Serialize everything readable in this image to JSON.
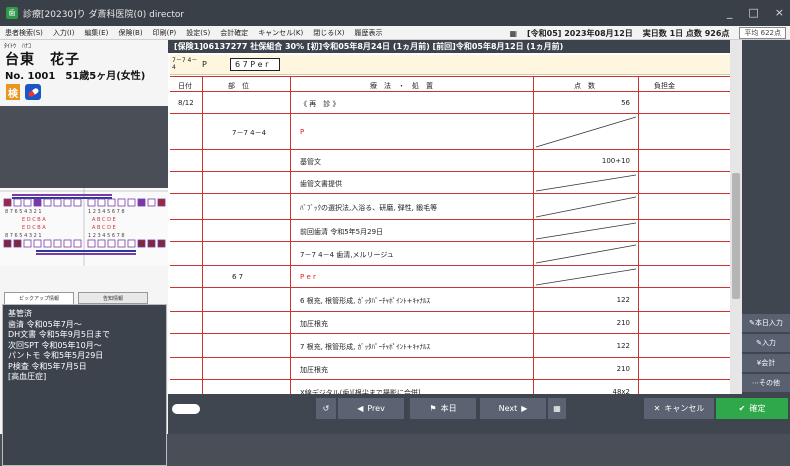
{
  "window": {
    "title": "診療[20230]り ダ斎科医院(0) director",
    "controls": [
      "_",
      "□",
      "×"
    ]
  },
  "menu": {
    "items": [
      "患者検索(S)",
      "入力(I)",
      "編集(E)",
      "保険(B)",
      "印刷(P)",
      "設定(S)",
      "会計確定",
      "キャンセル(K)",
      "閉じる(X)",
      "履歴表示"
    ],
    "date_label": "[令和05] 2023年08月12日",
    "visit_info": "実日数 1日 点数 926点",
    "points_box": "平均 622点"
  },
  "patient": {
    "kana": "ﾀｲﾄｳ　ﾊﾅｺ",
    "name": "台東　花子",
    "number_line": "No.  1001　51歳5ヶ月(女性)",
    "badge_ken": "検"
  },
  "left_tabs": [
    "ピックアップ情報",
    "告知情報"
  ],
  "pickup": {
    "lines": [
      "基管済",
      "歯清 令和05年7月～",
      "DH文書 令和5年9月5日まで",
      "次回SPT 令和05年10月～",
      "パントモ 令和5年5月29日",
      "P検査 令和5年7月5日",
      "[高血圧症]"
    ]
  },
  "insurance_bar": "[保険1]06137277 社保組合 30%  [初]令和05年8月24日 (1ヵ月前)  [前回]令和05年8月12日 (1ヵ月前)",
  "header_cell": {
    "tooth": "7－7 4－4",
    "code": "P",
    "entry": "6 7 P e r"
  },
  "columns": {
    "date": "日付",
    "site": "部　位",
    "treatment": "療　法　・　処　置",
    "points": "点　数",
    "copay": "負担金"
  },
  "rows": [
    {
      "date": "8/12",
      "site": "",
      "text": "《 再　診 》",
      "points": "56",
      "slash": false,
      "red": false
    },
    {
      "date": "",
      "site": "7－7 4－4",
      "text": "P",
      "points": "",
      "slash": true,
      "red": true
    },
    {
      "date": "",
      "site": "",
      "text": "基管文",
      "points": "100+10",
      "slash": false,
      "red": false
    },
    {
      "date": "",
      "site": "",
      "text": "歯管文書提供",
      "points": "",
      "slash": true,
      "red": false
    },
    {
      "date": "",
      "site": "",
      "text": "ﾊﾞﾌﾞｯｸの選択法,入浴る、研磨, 弾性, 鍛毛等",
      "points": "",
      "slash": true,
      "red": false
    },
    {
      "date": "",
      "site": "",
      "text": "前回歯清 令和5年5月29日",
      "points": "",
      "slash": true,
      "red": false
    },
    {
      "date": "",
      "site": "",
      "text": "7－7 4－4 歯清,メルリージュ",
      "points": "",
      "slash": true,
      "red": false
    },
    {
      "date": "",
      "site": "6 7",
      "text": "P e r",
      "points": "",
      "slash": true,
      "red": true
    },
    {
      "date": "",
      "site": "",
      "text": "6 根充, 根管形成, ｶﾞｯﾀﾊﾟｰﾁｬﾎﾟｲﾝﾄ+ｷｬﾅﾙｽ",
      "points": "122",
      "slash": false,
      "red": false
    },
    {
      "date": "",
      "site": "",
      "text": "加圧根充",
      "points": "210",
      "slash": false,
      "red": false
    },
    {
      "date": "",
      "site": "",
      "text": "7 根充, 根管形成, ｶﾞｯﾀﾊﾟｰﾁｬﾎﾟｲﾝﾄ+ｷｬﾅﾙｽ",
      "points": "122",
      "slash": false,
      "red": false
    },
    {
      "date": "",
      "site": "",
      "text": "加圧根充",
      "points": "210",
      "slash": false,
      "red": false
    },
    {
      "date": "",
      "site": "",
      "text": "X線デジタル(歯)[根尖まで撮影に合併]",
      "points": "48x2",
      "slash": false,
      "red": false
    }
  ],
  "right_buttons": [
    "本日入力",
    "入力",
    "会計",
    "その他"
  ],
  "bottom": {
    "prev": "Prev",
    "today": "本日",
    "next": "Next",
    "cancel": "キャンセル",
    "ok": "確定"
  },
  "colors": {
    "accent_red": "#cc3333",
    "ok_green": "#2ea84a",
    "dark_panel": "#3f4650"
  }
}
